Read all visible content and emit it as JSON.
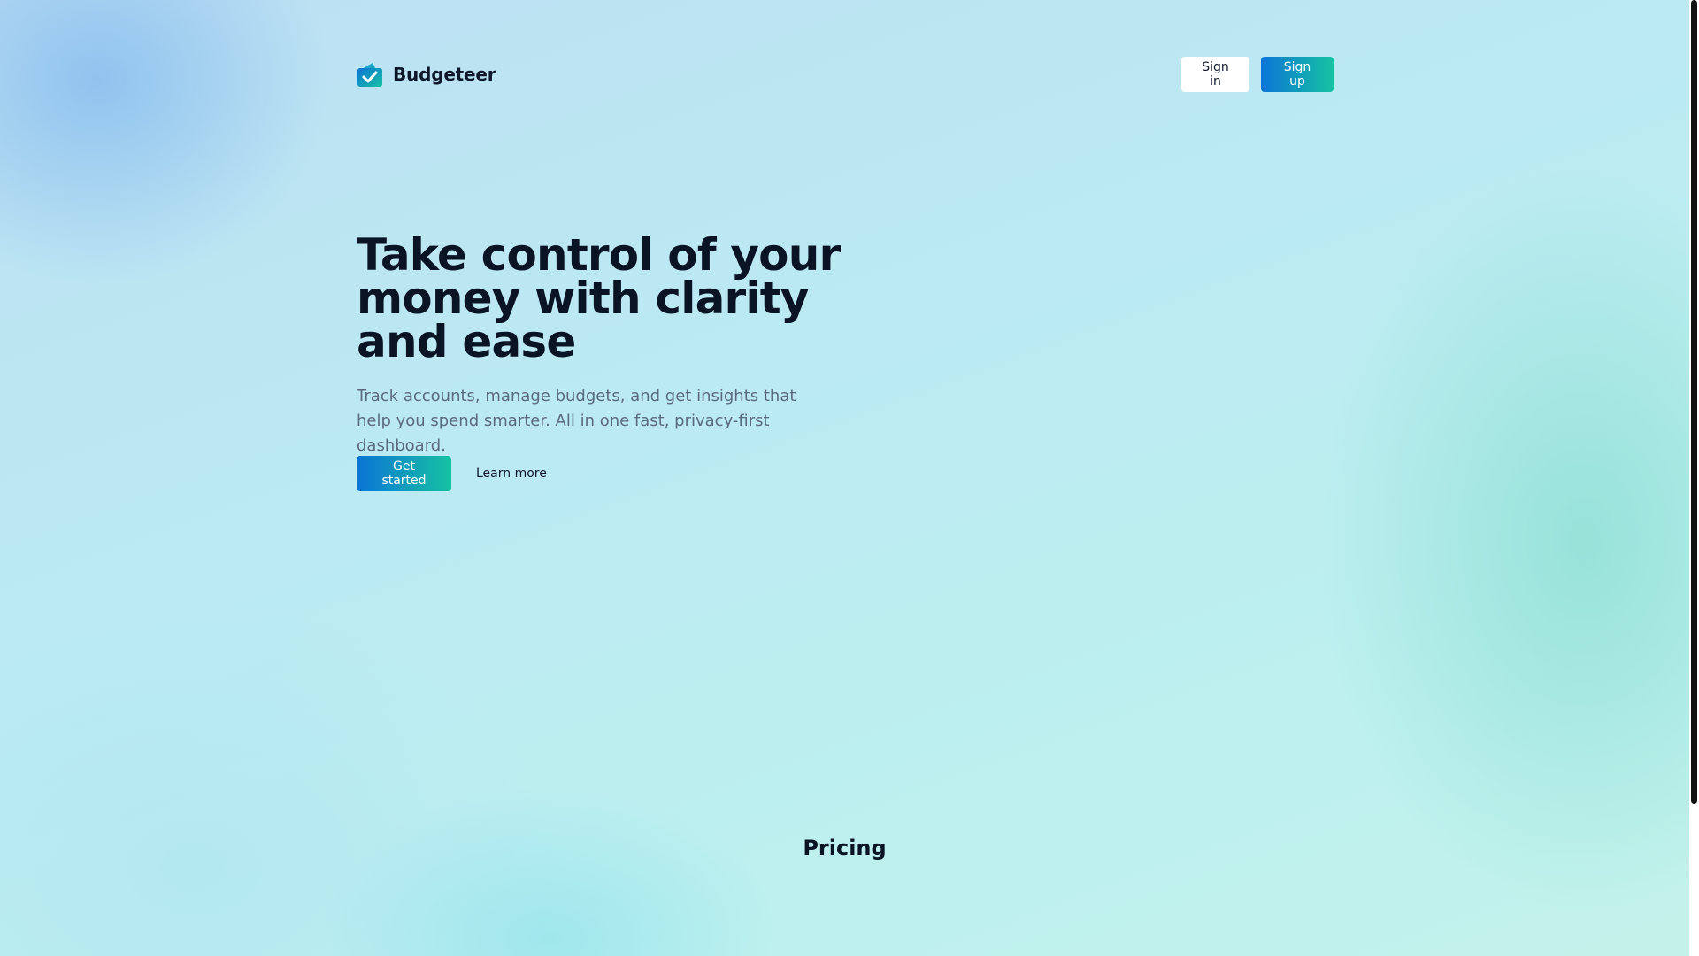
{
  "brand": {
    "name": "Budgeteer",
    "icon": "wallet-check-icon"
  },
  "header": {
    "sign_in_label": "Sign in",
    "sign_up_label": "Sign up"
  },
  "hero": {
    "title": "Take control of your money with clarity and ease",
    "subtitle": "Track accounts, manage budgets, and get insights that help you spend smarter. All in one fast, privacy-first dashboard.",
    "primary_cta": "Get started",
    "secondary_cta": "Learn more"
  },
  "pricing": {
    "heading": "Pricing"
  },
  "colors": {
    "accent_start": "#0b74d6",
    "accent_end": "#16c2a2",
    "heading_text": "#0b1424",
    "muted_text": "#5b6b7d"
  }
}
